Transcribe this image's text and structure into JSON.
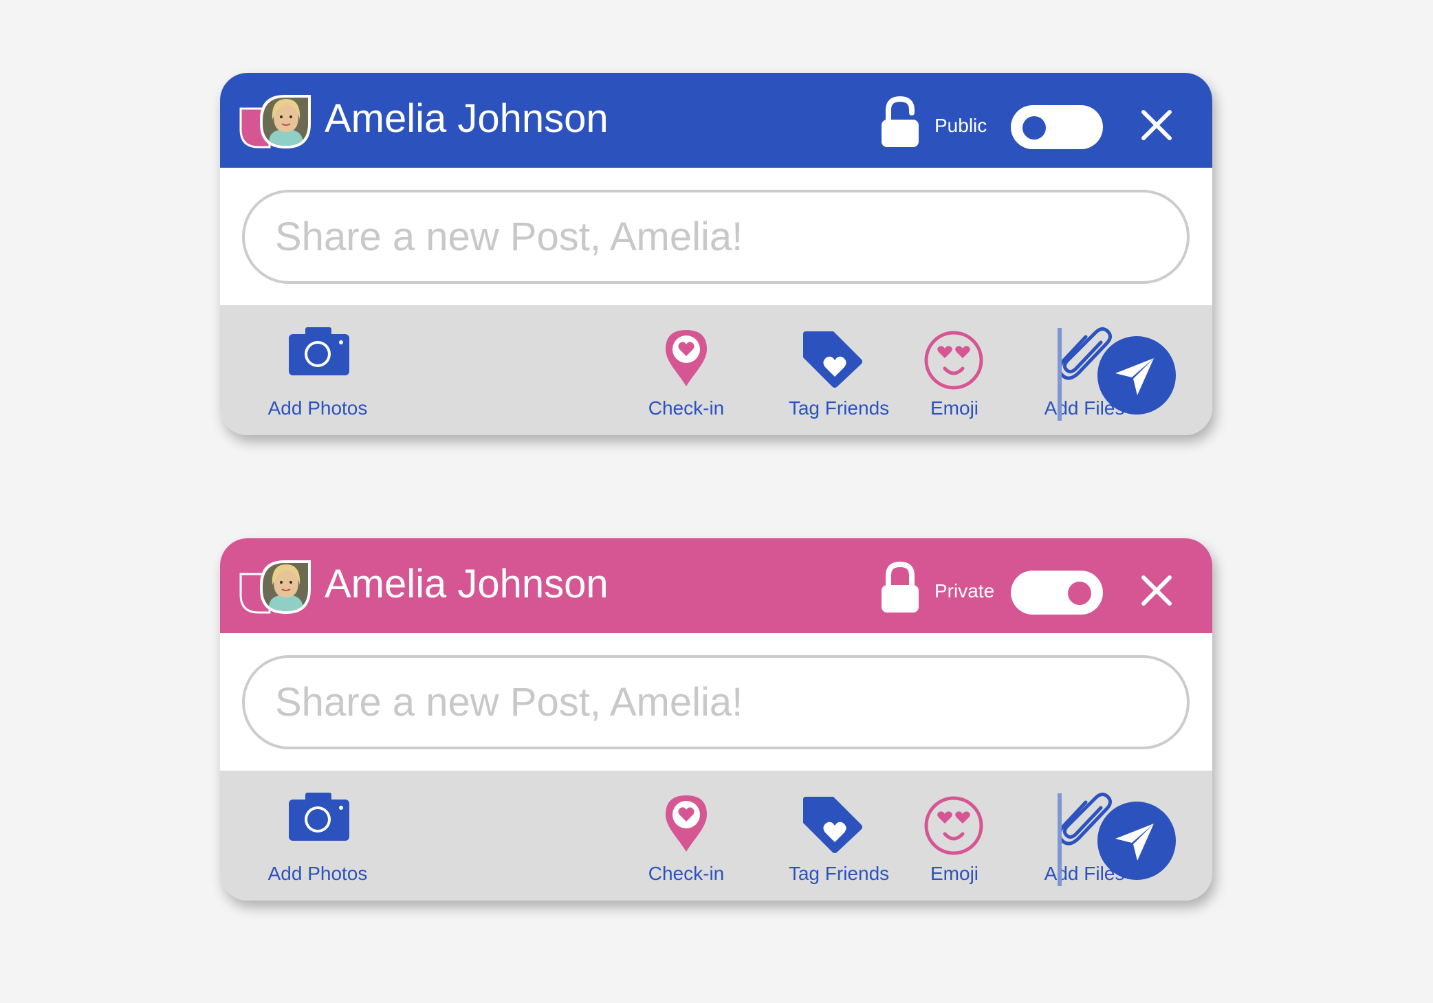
{
  "colors": {
    "blue": "#2b52bd",
    "pink": "#d65593",
    "toolbar_bg": "#dcdcdc",
    "placeholder": "#c8c8c8"
  },
  "cards": [
    {
      "theme": "blue",
      "user_name": "Amelia Johnson",
      "privacy_label": "Public",
      "lock_icon": "unlocked-padlock-icon",
      "toggle_on": false,
      "placeholder": "Share a new Post, Amelia!",
      "actions": [
        {
          "label": "Add Photos",
          "icon": "camera-icon"
        },
        {
          "label": "Check-in",
          "icon": "location-pin-icon"
        },
        {
          "label": "Tag  Friends",
          "icon": "tag-icon"
        },
        {
          "label": "Emoji",
          "icon": "heart-eyes-emoji-icon"
        },
        {
          "label": "Add Files",
          "icon": "paperclip-icon"
        }
      ],
      "send_icon": "paper-plane-icon",
      "close_icon": "close-icon"
    },
    {
      "theme": "pink",
      "user_name": "Amelia Johnson",
      "privacy_label": "Private",
      "lock_icon": "locked-padlock-icon",
      "toggle_on": true,
      "placeholder": "Share a new Post, Amelia!",
      "actions": [
        {
          "label": "Add Photos",
          "icon": "camera-icon"
        },
        {
          "label": "Check-in",
          "icon": "location-pin-icon"
        },
        {
          "label": "Tag  Friends",
          "icon": "tag-icon"
        },
        {
          "label": "Emoji",
          "icon": "heart-eyes-emoji-icon"
        },
        {
          "label": "Add Files",
          "icon": "paperclip-icon"
        }
      ],
      "send_icon": "paper-plane-icon",
      "close_icon": "close-icon"
    }
  ]
}
